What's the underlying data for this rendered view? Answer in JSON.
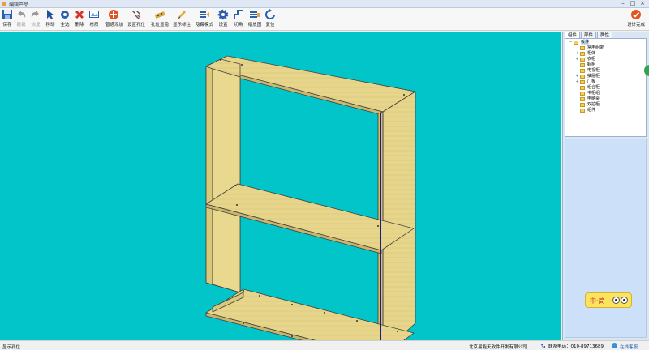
{
  "window": {
    "title": "编辑产品"
  },
  "toolbar": {
    "items": [
      {
        "label": "保存",
        "icon": "save-icon",
        "enabled": true
      },
      {
        "label": "撤销",
        "icon": "undo-icon",
        "enabled": false
      },
      {
        "label": "恢复",
        "icon": "redo-icon",
        "enabled": false
      },
      {
        "label": "移动",
        "icon": "cursor-icon",
        "enabled": true
      },
      {
        "label": "全选",
        "icon": "select-all-icon",
        "enabled": true
      },
      {
        "label": "删除",
        "icon": "delete-icon",
        "enabled": true
      },
      {
        "label": "材质",
        "icon": "material-icon",
        "enabled": true
      },
      {
        "label": "普通添加",
        "icon": "add-icon",
        "enabled": true
      },
      {
        "label": "设置孔位",
        "icon": "tools-icon",
        "enabled": true
      },
      {
        "label": "孔位显隐",
        "icon": "hole-toggle-icon",
        "enabled": true
      },
      {
        "label": "显示标注",
        "icon": "pencil-icon",
        "enabled": true
      },
      {
        "label": "隐藏模式",
        "icon": "hide-mode-icon",
        "enabled": true
      },
      {
        "label": "设置",
        "icon": "gear-icon",
        "enabled": true
      },
      {
        "label": "切角",
        "icon": "chamfer-icon",
        "enabled": true
      },
      {
        "label": "缩放图",
        "icon": "zoom-map-icon",
        "enabled": true
      },
      {
        "label": "复位",
        "icon": "reset-icon",
        "enabled": true
      }
    ],
    "finish_label": "设计完成"
  },
  "panel": {
    "tabs": [
      "组件",
      "部件",
      "属性"
    ],
    "tree": [
      {
        "label": "板件",
        "level": 0,
        "expand": "−",
        "selected": true
      },
      {
        "label": "常用组架",
        "level": 1,
        "expand": ""
      },
      {
        "label": "柜体",
        "level": 1,
        "expand": "+"
      },
      {
        "label": "衣柜",
        "level": 1,
        "expand": "+"
      },
      {
        "label": "橱柜",
        "level": 1,
        "expand": ""
      },
      {
        "label": "电视柜",
        "level": 1,
        "expand": ""
      },
      {
        "label": "抽屉柜",
        "level": 1,
        "expand": "+"
      },
      {
        "label": "门板",
        "level": 1,
        "expand": "+"
      },
      {
        "label": "组合柜",
        "level": 1,
        "expand": ""
      },
      {
        "label": "书柜组",
        "level": 1,
        "expand": ""
      },
      {
        "label": "电脑桌",
        "level": 1,
        "expand": ""
      },
      {
        "label": "双拉柜",
        "level": 1,
        "expand": ""
      },
      {
        "label": "组件",
        "level": 1,
        "expand": ""
      }
    ]
  },
  "widget": {
    "text": "中·简"
  },
  "status": {
    "left": "显示孔位",
    "company": "北京易能天软件开发有限公司",
    "phone": "联系电话：010-89713689",
    "online": "在线客服"
  },
  "colors": {
    "viewport_bg": "#02c5c9",
    "board": "#e8d98c",
    "board_edge": "#3f3f3f",
    "edge_highlight": "#1a1a8c"
  }
}
